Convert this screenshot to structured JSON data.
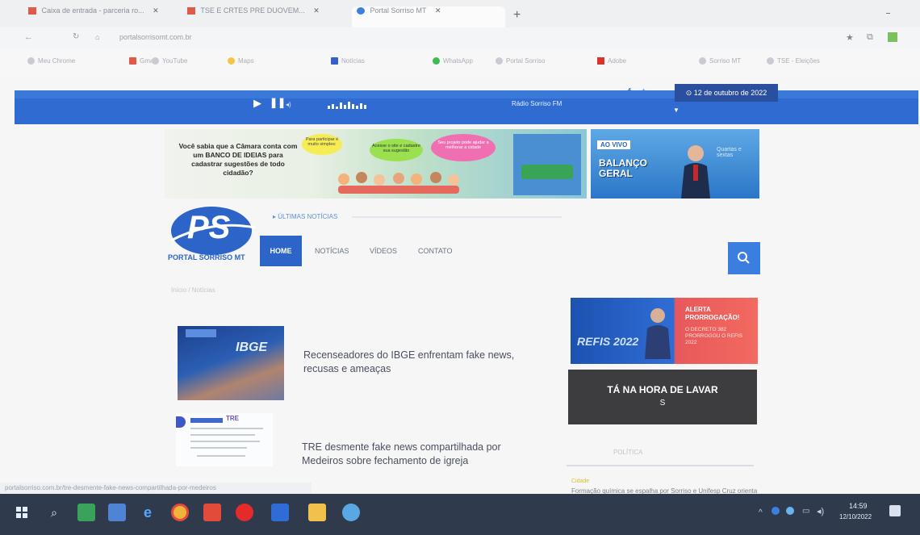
{
  "browser": {
    "tabs": [
      {
        "label": "Caixa de entrada - parceria ro..."
      },
      {
        "label": "TSE E CRTES PRE DUOVEM..."
      },
      {
        "label": "Portal Sorriso MT"
      }
    ],
    "new_tab": "+",
    "address": "portalsorrisomt.com.br",
    "bookmarks": [
      {
        "label": "Meu Chrome"
      },
      {
        "label": "Gmail"
      },
      {
        "label": "YouTube"
      },
      {
        "label": "Maps"
      },
      {
        "label": "Notícias"
      },
      {
        "label": "WhatsApp"
      },
      {
        "label": "Portal Sorriso"
      },
      {
        "label": "Adobe"
      },
      {
        "label": "Sorriso MT"
      },
      {
        "label": "TSE - Eleições"
      }
    ]
  },
  "player": {
    "station": "Rádio Sorriso FM",
    "date": "⊙ 12 de outubro de 2022",
    "social": [
      "f",
      "t"
    ]
  },
  "hero_banner": {
    "headline": "Você sabia que a Câmara conta com um BANCO DE IDEIAS para cadastrar sugestões de todo cidadão?",
    "bubble1": "Para participar é muito simples:",
    "bubble2": "Acesse o site e cadastre sua sugestão",
    "bubble3": "Seu projeto pode ajudar a melhorar a cidade"
  },
  "hero2": {
    "badge": "AO VIVO",
    "title": "BALANÇO GERAL",
    "subtitle": "Quartas e sextas"
  },
  "site": {
    "logo_mark": "PS",
    "logo_text": "PORTAL SORRISO MT",
    "ticker_label": "ÚLTIMAS NOTÍCIAS",
    "nav": [
      {
        "label": "HOME"
      },
      {
        "label": "NOTÍCIAS"
      },
      {
        "label": "VÍDEOS"
      },
      {
        "label": "CONTATO"
      }
    ],
    "breadcrumb": "Início / Notícias"
  },
  "articles": [
    {
      "title": "Recenseadores do IBGE enfrentam fake news, recusas e ameaças",
      "thumb_text": "IBGE"
    },
    {
      "title": "TRE desmente fake news compartilhada por Medeiros sobre fechamento de igreja",
      "thumb_text": "TRE"
    }
  ],
  "sidebar": {
    "ad1_left": "REFIS 2022",
    "ad1_right_title": "ALERTA PRORROGAÇÃO!",
    "ad1_right_text": "O DECRETO 382 PRORROGOU O REFIS 2022",
    "ad2_title": "TÁ NA HORA DE LAVAR",
    "ad2_sub": "S",
    "section_label": "POLÍTICA",
    "news_tag": "Cidade",
    "news_snippet": "Formação química se espalha por Sorriso e Unifesp Cruz orienta aos moradores..."
  },
  "status_url": "portalsorriso.com.br/tre-desmente-fake-news-compartilhada-por-medeiros",
  "taskbar": {
    "time": "14:59",
    "date": "12/10/2022"
  }
}
